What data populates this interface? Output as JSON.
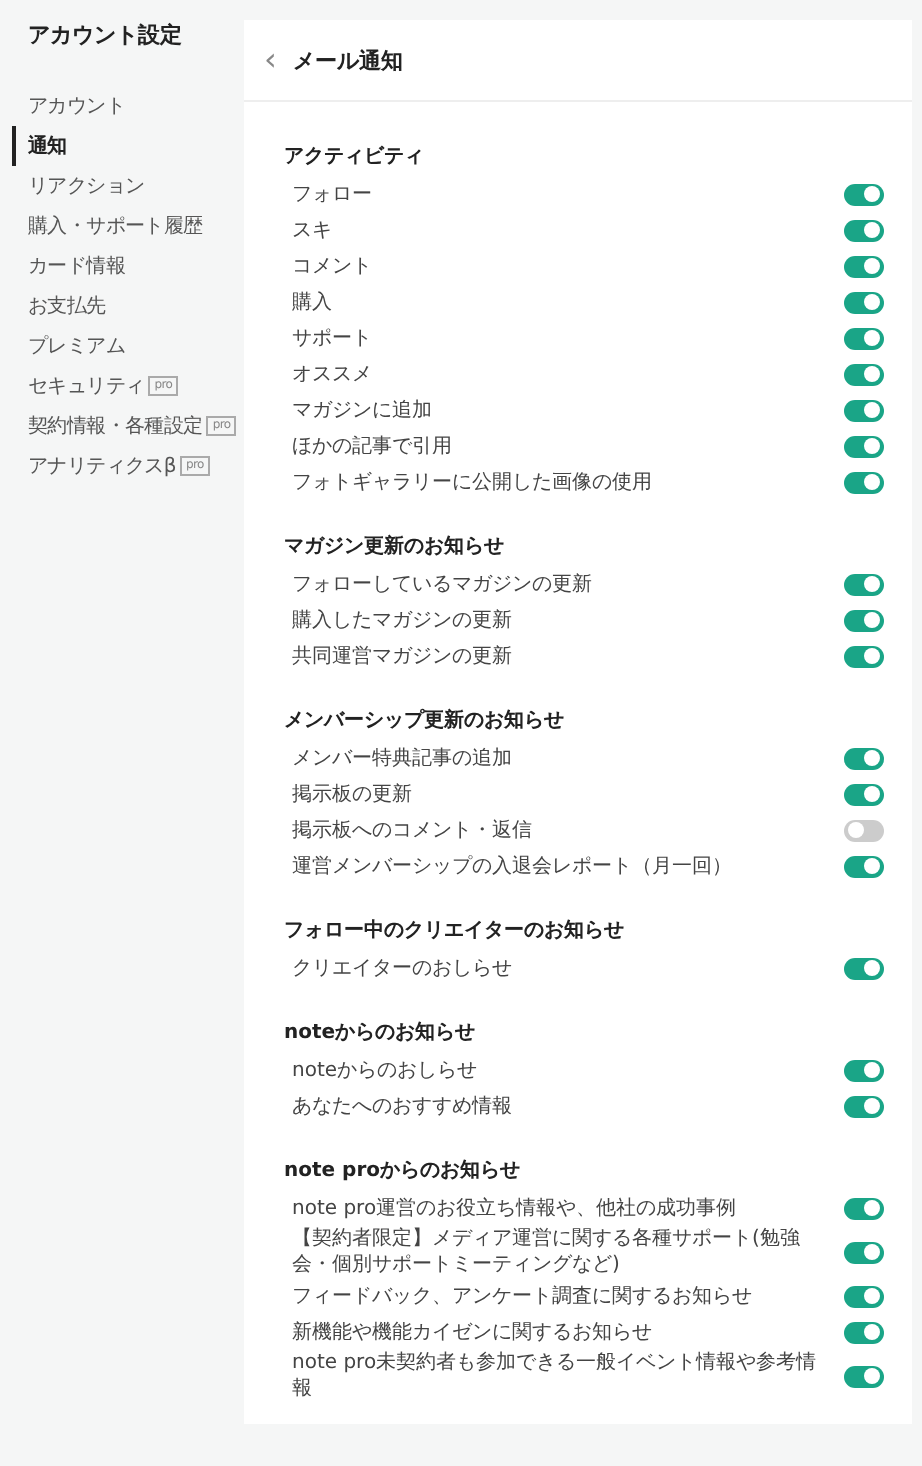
{
  "sidebar": {
    "title": "アカウント設定",
    "items": [
      {
        "label": "アカウント",
        "selected": false
      },
      {
        "label": "通知",
        "selected": true
      },
      {
        "label": "リアクション",
        "selected": false
      },
      {
        "label": "購入・サポート履歴",
        "selected": false
      },
      {
        "label": "カード情報",
        "selected": false
      },
      {
        "label": "お支払先",
        "selected": false
      },
      {
        "label": "プレミアム",
        "selected": false
      },
      {
        "label": "セキュリティ",
        "selected": false,
        "badge": "pro"
      },
      {
        "label": "契約情報・各種設定",
        "selected": false,
        "badge": "pro"
      },
      {
        "label": "アナリティクスβ",
        "selected": false,
        "badge": "pro"
      }
    ]
  },
  "panel": {
    "back": "‹",
    "title": "メール通知",
    "sections": [
      {
        "heading": "アクティビティ",
        "items": [
          {
            "label": "フォロー",
            "on": true
          },
          {
            "label": "スキ",
            "on": true
          },
          {
            "label": "コメント",
            "on": true
          },
          {
            "label": "購入",
            "on": true
          },
          {
            "label": "サポート",
            "on": true
          },
          {
            "label": "オススメ",
            "on": true
          },
          {
            "label": "マガジンに追加",
            "on": true
          },
          {
            "label": "ほかの記事で引用",
            "on": true
          },
          {
            "label": "フォトギャラリーに公開した画像の使用",
            "on": true
          }
        ]
      },
      {
        "heading": "マガジン更新のお知らせ",
        "items": [
          {
            "label": "フォローしているマガジンの更新",
            "on": true
          },
          {
            "label": "購入したマガジンの更新",
            "on": true
          },
          {
            "label": "共同運営マガジンの更新",
            "on": true
          }
        ]
      },
      {
        "heading": "メンバーシップ更新のお知らせ",
        "items": [
          {
            "label": "メンバー特典記事の追加",
            "on": true
          },
          {
            "label": "掲示板の更新",
            "on": true
          },
          {
            "label": "掲示板へのコメント・返信",
            "on": false
          },
          {
            "label": "運営メンバーシップの入退会レポート（月一回）",
            "on": true
          }
        ]
      },
      {
        "heading": "フォロー中のクリエイターのお知らせ",
        "items": [
          {
            "label": "クリエイターのおしらせ",
            "on": true
          }
        ]
      },
      {
        "heading": "noteからのお知らせ",
        "items": [
          {
            "label": "noteからのおしらせ",
            "on": true
          },
          {
            "label": "あなたへのおすすめ情報",
            "on": true
          }
        ]
      },
      {
        "heading": "note proからのお知らせ",
        "items": [
          {
            "label": "note pro運営のお役立ち情報や、他社の成功事例",
            "on": true
          },
          {
            "label": "【契約者限定】メディア運営に関する各種サポート(勉強会・個別サポートミーティングなど)",
            "on": true
          },
          {
            "label": "フィードバック、アンケート調査に関するお知らせ",
            "on": true
          },
          {
            "label": "新機能や機能カイゼンに関するお知らせ",
            "on": true
          },
          {
            "label": "note pro未契約者も参加できる一般イベント情報や参考情報",
            "on": true
          }
        ]
      }
    ]
  }
}
